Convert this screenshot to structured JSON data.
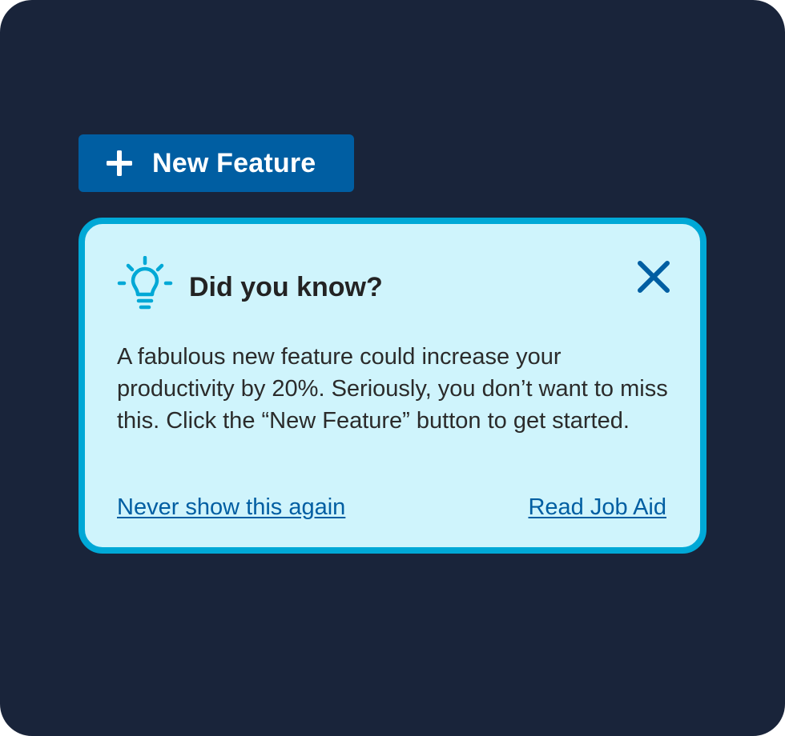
{
  "colors": {
    "page_background": "#19243a",
    "button_primary": "#005ea2",
    "card_background": "#cff4fc",
    "card_border": "#00a8d6",
    "link": "#005ea2",
    "icon_accent": "#00a8d6"
  },
  "feature_button": {
    "icon": "plus-icon",
    "label": "New Feature"
  },
  "tip": {
    "icon": "lightbulb-icon",
    "title": "Did you know?",
    "body": "A fabulous new feature could increase your productivity by 20%. Seriously, you don’t want to miss this. Click the “New Feature” button to get started.",
    "close_icon": "close-icon",
    "links": {
      "dismiss": "Never show this again",
      "job_aid": "Read Job Aid"
    }
  }
}
